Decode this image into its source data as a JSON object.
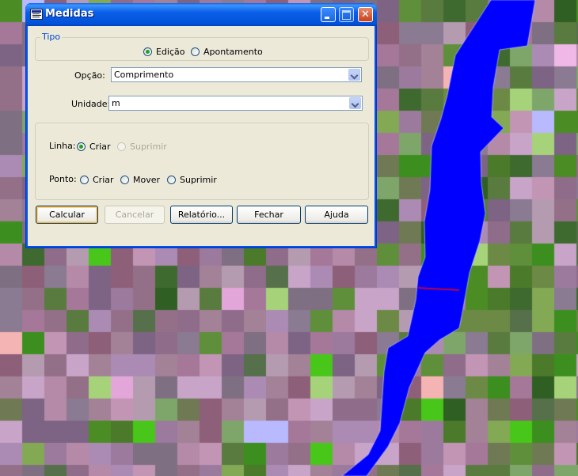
{
  "window": {
    "title": "Medidas"
  },
  "tipo": {
    "legend": "Tipo",
    "options": [
      {
        "label": "Edição",
        "checked": true
      },
      {
        "label": "Apontamento",
        "checked": false
      }
    ]
  },
  "opcao": {
    "label": "Opção:",
    "value": "Comprimento"
  },
  "unidade": {
    "label": "Unidade:",
    "value": "m"
  },
  "linha": {
    "label": "Linha:",
    "options": [
      {
        "label": "Criar",
        "checked": true,
        "enabled": true
      },
      {
        "label": "Suprimir",
        "checked": false,
        "enabled": false
      }
    ]
  },
  "ponto": {
    "label": "Ponto:",
    "options": [
      {
        "label": "Criar",
        "checked": false
      },
      {
        "label": "Mover",
        "checked": false
      },
      {
        "label": "Suprimir",
        "checked": false
      }
    ]
  },
  "buttons": {
    "calcular": "Calcular",
    "cancelar": "Cancelar",
    "relatorio": "Relatório...",
    "fechar": "Fechar",
    "ajuda": "Ajuda"
  },
  "map": {
    "river_color": "#0000ff",
    "measure_line_color": "#ff0000"
  }
}
